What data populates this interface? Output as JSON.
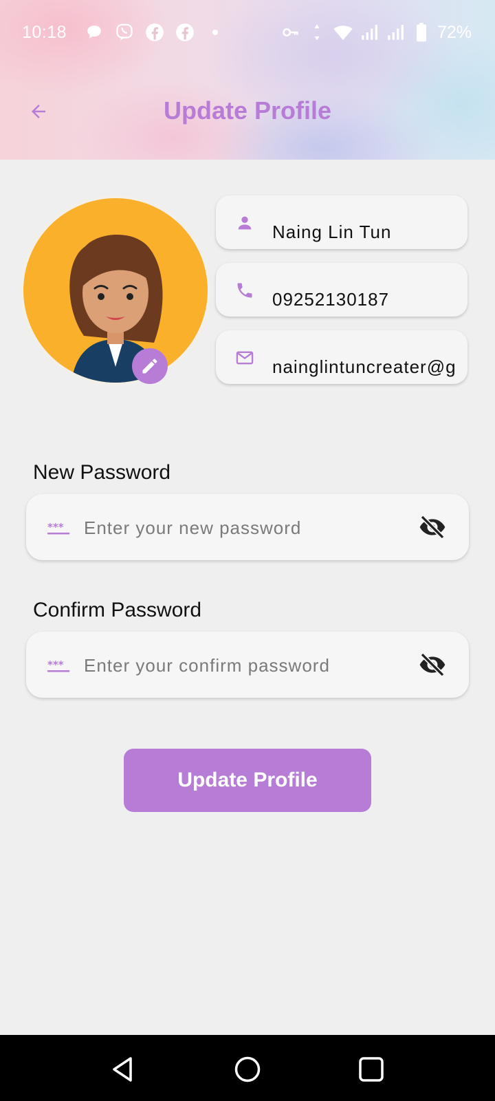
{
  "status_bar": {
    "time": "10:18",
    "battery": "72%",
    "icons_left": [
      "chat-bubble-icon",
      "viber-icon",
      "facebook-icon",
      "facebook-icon",
      "dot-icon"
    ],
    "icons_right": [
      "vpn-key-icon",
      "data-arrows-icon",
      "wifi-icon",
      "signal-icon",
      "signal-icon",
      "battery-icon"
    ]
  },
  "app_bar": {
    "title": "Update Profile",
    "back_icon": "arrow-left-icon"
  },
  "profile": {
    "name": "Naing Lin Tun",
    "phone": "09252130187",
    "email": "nainglintuncreater@g",
    "name_icon": "person-icon",
    "phone_icon": "phone-icon",
    "email_icon": "mail-icon",
    "avatar_edit_icon": "pencil-icon"
  },
  "new_password": {
    "label": "New Password",
    "placeholder": "Enter your new password",
    "value": ""
  },
  "confirm_password": {
    "label": "Confirm Password",
    "placeholder": "Enter your confirm password",
    "value": ""
  },
  "actions": {
    "update_label": "Update Profile"
  },
  "colors": {
    "accent": "#b77dd6",
    "background": "#efeff0",
    "avatar_bg": "#fbb02c"
  }
}
